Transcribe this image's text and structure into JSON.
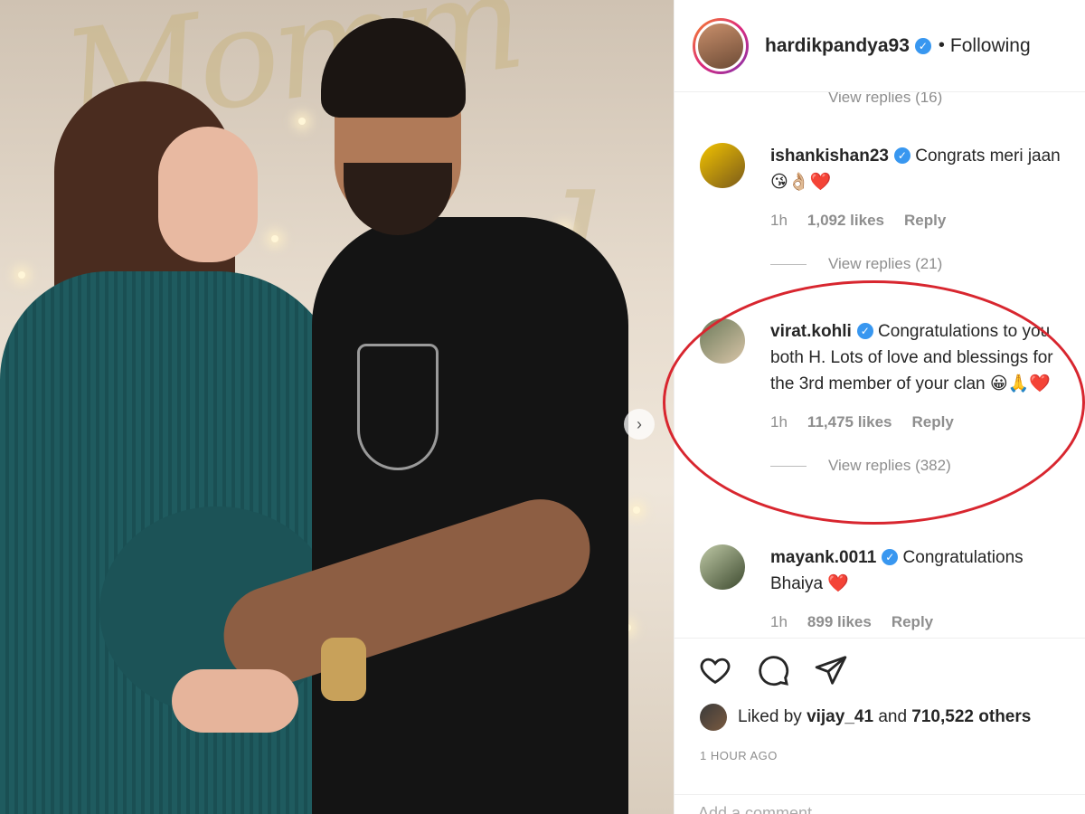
{
  "post": {
    "username": "hardikpandya93",
    "separator": "•",
    "follow_status": "Following"
  },
  "partial_view_replies": "View replies (16)",
  "comments": [
    {
      "username": "ishankishan23",
      "text": "Congrats meri jaan",
      "emoji": "😘👌🏼❤️",
      "time": "1h",
      "likes": "1,092 likes",
      "reply_label": "Reply",
      "view_replies": "View replies (21)"
    },
    {
      "username": "virat.kohli",
      "text": "Congratulations to you both H. Lots of love and blessings for the 3rd member of your clan",
      "emoji": "😀🙏❤️",
      "time": "1h",
      "likes": "11,475 likes",
      "reply_label": "Reply",
      "view_replies": "View replies (382)"
    },
    {
      "username": "mayank.0011",
      "text": "Congratulations Bhaiya",
      "emoji": "❤️",
      "time": "1h",
      "likes": "899 likes",
      "reply_label": "Reply"
    }
  ],
  "likes_summary": {
    "prefix": "Liked by",
    "user": "vijay_41",
    "joiner": "and",
    "others": "710,522 others"
  },
  "timestamp": "1 HOUR AGO",
  "add_comment": {
    "placeholder": "Add a comment..."
  },
  "icons": {
    "like": "heart-icon",
    "comment": "comment-bubble-icon",
    "share": "paper-plane-icon",
    "verified": "verified-badge-icon",
    "carousel_next": "chevron-right-icon"
  },
  "colors": {
    "highlight": "#d8262f",
    "verified": "#3897f0",
    "meta_text": "#8e8e8e"
  }
}
